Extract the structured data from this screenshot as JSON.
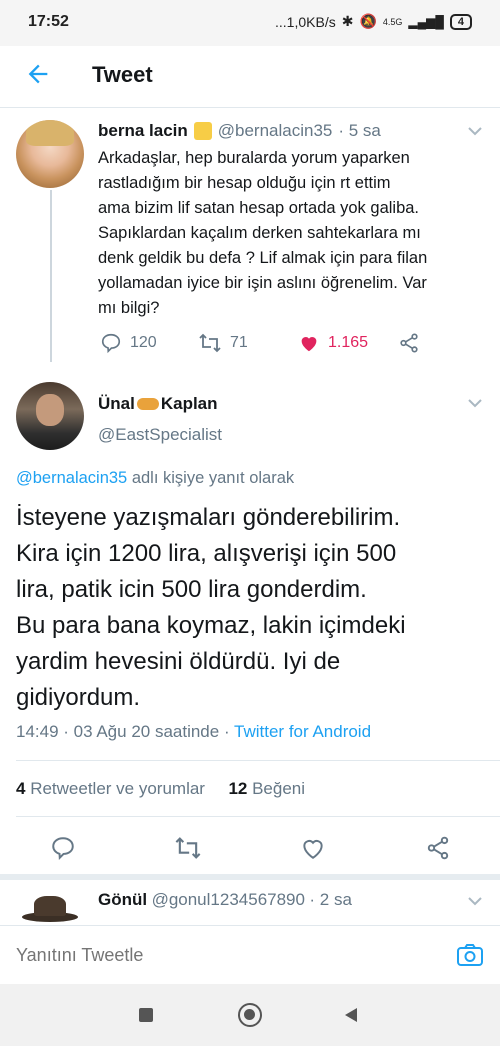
{
  "status": {
    "time": "17:52",
    "indicators": "...1,0KB/s",
    "network": "4.5G",
    "battery": "4"
  },
  "header": {
    "title": "Tweet"
  },
  "parent_tweet": {
    "name": "berna lacin",
    "name_emoji": "🟨",
    "handle": "@bernalacin35",
    "time": "· 5 sa",
    "lines": [
      "Arkadaşlar, hep buralarda yorum yaparken",
      "rastladığım  bir hesap olduğu için  rt ettim",
      "ama bizim lif satan hesap ortada yok galiba.",
      "Sapıklardan kaçalım derken sahtekarlara mı",
      "denk geldik bu defa ? Lif almak için para filan",
      "yollamadan iyice bir işin aslını öğrenelim. Var",
      "mı bilgi?"
    ],
    "replies": "120",
    "retweets": "71",
    "likes": "1.165"
  },
  "main_tweet": {
    "name_first": "Ünal",
    "name_emoji": "🐆",
    "name_last": "Kaplan",
    "handle": "@EastSpecialist",
    "reply_to_handle": "@bernalacin35",
    "reply_to_suffix": " adlı kişiye yanıt olarak",
    "lines": [
      "İsteyene yazışmaları gönderebilirim.",
      "Kira için 1200 lira, alışverişi için 500",
      "lira, patik icin 500 lira gonderdim.",
      "Bu para bana koymaz, lakin içimdeki",
      "yardim hevesini öldürdü. Iyi de",
      "gidiyordum."
    ],
    "timestamp": "14:49 · 03 Ağu 20 saatinde · ",
    "source": "Twitter for Android",
    "retweet_count": "4",
    "retweet_label": " Retweetler ve yorumlar",
    "like_count": "12",
    "like_label": " Beğeni"
  },
  "next_tweet": {
    "name": "Gönül",
    "handle": "@gonul1234567890",
    "time": "· 2 sa"
  },
  "reply_bar": {
    "placeholder": "Yanıtını Tweetle"
  },
  "colors": {
    "accent": "#1da1f2",
    "like": "#e0245e",
    "text": "#14171a",
    "muted": "#657786"
  }
}
